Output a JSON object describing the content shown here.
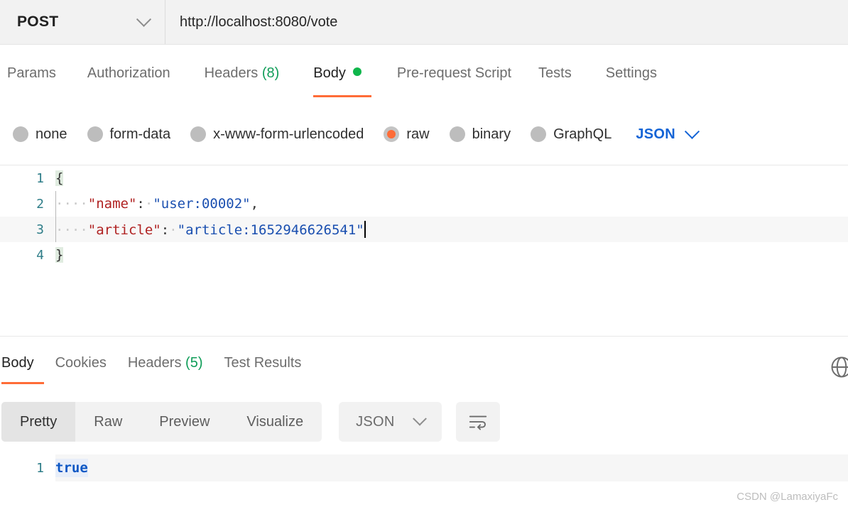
{
  "request": {
    "method": "POST",
    "url": "http://localhost:8080/vote",
    "tabs": [
      {
        "label": "Params",
        "count": "",
        "active": false
      },
      {
        "label": "Authorization",
        "count": "",
        "active": false
      },
      {
        "label": "Headers",
        "count": "(8)",
        "active": false
      },
      {
        "label": "Body",
        "count": "",
        "active": true
      },
      {
        "label": "Pre-request Script",
        "count": "",
        "active": false
      },
      {
        "label": "Tests",
        "count": "",
        "active": false
      },
      {
        "label": "Settings",
        "count": "",
        "active": false
      }
    ],
    "body_modes": [
      {
        "label": "none",
        "selected": false
      },
      {
        "label": "form-data",
        "selected": false
      },
      {
        "label": "x-www-form-urlencoded",
        "selected": false
      },
      {
        "label": "raw",
        "selected": true
      },
      {
        "label": "binary",
        "selected": false
      },
      {
        "label": "GraphQL",
        "selected": false
      }
    ],
    "raw_format": "JSON",
    "editor": {
      "lines": [
        {
          "number": "1",
          "active": false
        },
        {
          "number": "2",
          "active": false
        },
        {
          "number": "3",
          "active": true
        },
        {
          "number": "4",
          "active": false
        }
      ],
      "l1_brace": "{",
      "l2_indent": "····",
      "l2_key": "\"name\"",
      "l2_colon": ":",
      "l2_space": "·",
      "l2_value": "\"user:00002\"",
      "l2_comma": ",",
      "l3_indent": "····",
      "l3_key": "\"article\"",
      "l3_colon": ":",
      "l3_space": "·",
      "l3_value": "\"article:1652946626541\"",
      "l4_brace": "}"
    }
  },
  "response": {
    "tabs": [
      {
        "label": "Body",
        "count": "",
        "active": true
      },
      {
        "label": "Cookies",
        "count": "",
        "active": false
      },
      {
        "label": "Headers",
        "count": "(5)",
        "active": false
      },
      {
        "label": "Test Results",
        "count": "",
        "active": false
      }
    ],
    "view_modes": [
      {
        "label": "Pretty",
        "active": true
      },
      {
        "label": "Raw",
        "active": false
      },
      {
        "label": "Preview",
        "active": false
      },
      {
        "label": "Visualize",
        "active": false
      }
    ],
    "format": "JSON",
    "body": {
      "line_number": "1",
      "value": "true"
    }
  },
  "watermark": "CSDN @LamaxiyaFc",
  "colors": {
    "accent_orange": "#ff6c37",
    "link_blue": "#1464d6",
    "status_green": "#0fb64b",
    "count_green": "#0f9d58"
  }
}
